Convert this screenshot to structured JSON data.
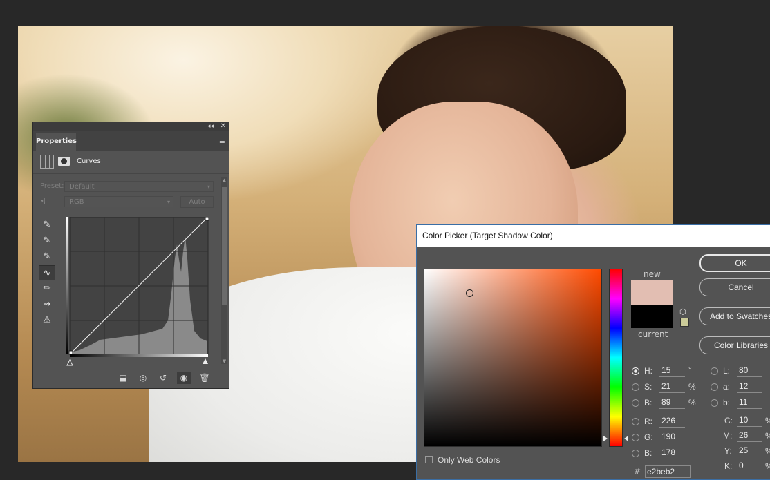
{
  "properties_panel": {
    "tab_label": "Properties",
    "adjustment_title": "Curves",
    "preset_label": "Preset:",
    "preset_value": "Default",
    "channel_value": "RGB",
    "auto_label": "Auto"
  },
  "color_picker": {
    "title": "Color Picker (Target Shadow Color)",
    "new_label": "new",
    "current_label": "current",
    "new_color": "#e2beb2",
    "current_color": "#000000",
    "buttons": {
      "ok": "OK",
      "cancel": "Cancel",
      "add_to_swatches": "Add to Swatches",
      "color_libraries": "Color Libraries"
    },
    "hsb": {
      "h": "15",
      "s": "21",
      "b": "89"
    },
    "rgb": {
      "r": "226",
      "g": "190",
      "b": "178"
    },
    "lab": {
      "l": "80",
      "a": "12",
      "b": "11"
    },
    "cmyk": {
      "c": "10",
      "m": "26",
      "y": "25",
      "k": "0"
    },
    "units": {
      "degree": "°",
      "percent": "%"
    },
    "labels": {
      "h": "H:",
      "s": "S:",
      "b": "B:",
      "r": "R:",
      "g": "G:",
      "b2": "B:",
      "l": "L:",
      "a": "a:",
      "lab_b": "b:",
      "c": "C:",
      "m": "M:",
      "y": "Y:",
      "k": "K:"
    },
    "only_web_colors": "Only Web Colors",
    "hex_value": "e2beb2",
    "hash": "#"
  }
}
